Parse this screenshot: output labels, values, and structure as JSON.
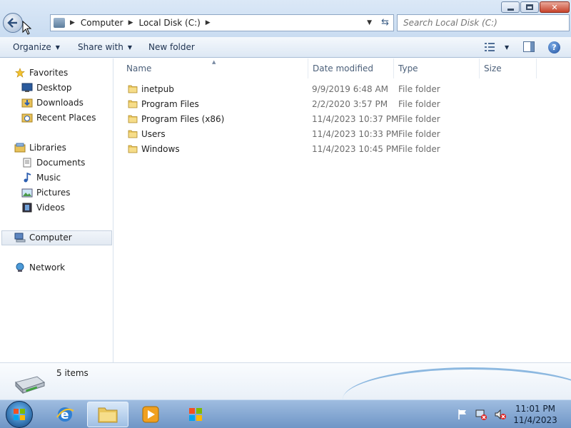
{
  "window": {
    "address": {
      "crumbs": [
        "Computer",
        "Local Disk (C:)"
      ]
    },
    "search": {
      "placeholder": "Search Local Disk (C:)"
    }
  },
  "toolbar": {
    "organize": "Organize",
    "share_with": "Share with",
    "new_folder": "New folder"
  },
  "nav": {
    "favorites": "Favorites",
    "desktop": "Desktop",
    "downloads": "Downloads",
    "recent_places": "Recent Places",
    "libraries": "Libraries",
    "documents": "Documents",
    "music": "Music",
    "pictures": "Pictures",
    "videos": "Videos",
    "computer": "Computer",
    "network": "Network"
  },
  "columns": {
    "name": "Name",
    "date_modified": "Date modified",
    "type": "Type",
    "size": "Size"
  },
  "files": [
    {
      "name": "inetpub",
      "date": "9/9/2019 6:48 AM",
      "type": "File folder"
    },
    {
      "name": "Program Files",
      "date": "2/2/2020 3:57 PM",
      "type": "File folder"
    },
    {
      "name": "Program Files (x86)",
      "date": "11/4/2023 10:37 PM",
      "type": "File folder"
    },
    {
      "name": "Users",
      "date": "11/4/2023 10:33 PM",
      "type": "File folder"
    },
    {
      "name": "Windows",
      "date": "11/4/2023 10:45 PM",
      "type": "File folder"
    }
  ],
  "details": {
    "item_count": "5 items"
  },
  "taskbar": {
    "time": "11:01 PM",
    "date": "11/4/2023"
  },
  "icons": {
    "folder": "folder-icon",
    "drive": "hard-drive-icon"
  }
}
